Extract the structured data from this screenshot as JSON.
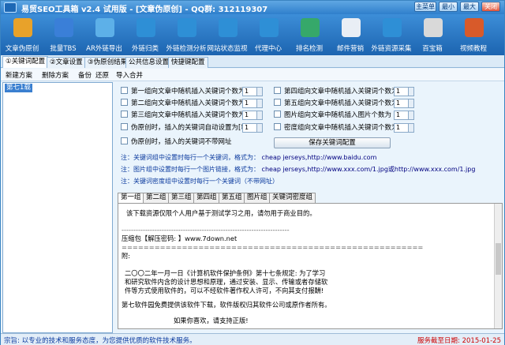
{
  "window": {
    "title": "易贸SEO工具箱 v2.4 试用版 - [文章伪原创] - QQ群: 312119307",
    "buttons": [
      "主菜单",
      "最小",
      "最大",
      "关闭"
    ]
  },
  "toolbar": {
    "items": [
      {
        "label": "文章伪原创",
        "icon": "books-icon",
        "color": "#e8a22a"
      },
      {
        "label": "批量TBS",
        "icon": "lightning-icon",
        "color": "#3a7fd8"
      },
      {
        "label": "AR外链导出",
        "icon": "monitor-icon",
        "color": "#5db0e8"
      },
      {
        "label": "外链归类",
        "icon": "globe-icon",
        "color": "#2e8fd6"
      },
      {
        "label": "外链检测分析",
        "icon": "globe-check-icon",
        "color": "#2e8fd6"
      },
      {
        "label": "网站状态监视",
        "icon": "globe-eye-icon",
        "color": "#2e8fd6"
      },
      {
        "label": "代理中心",
        "icon": "globe-proxy-icon",
        "color": "#2e8fd6"
      },
      {
        "label": "排名检测",
        "icon": "bar-chart-icon",
        "color": "#36a86a"
      },
      {
        "label": "邮件营销",
        "icon": "envelope-icon",
        "color": "#e9eef5"
      },
      {
        "label": "外链资源采集",
        "icon": "globe-collect-icon",
        "color": "#2e8fd6"
      },
      {
        "label": "百宝箱",
        "icon": "toolbox-icon",
        "color": "#d9d9d9"
      },
      {
        "label": "视频教程",
        "icon": "gift-icon",
        "color": "#d85a2a"
      }
    ]
  },
  "tabs": [
    "①关键词配置",
    "②文章设置",
    "③伪原创结果",
    "公共信息设置",
    "快捷键配置"
  ],
  "subbar": [
    "新建方案",
    "删除方案",
    "备份",
    "还原",
    "导入合并"
  ],
  "left": {
    "selected": "第七1载"
  },
  "options": {
    "left_col": [
      {
        "label": "第一组向文章中随机插入关键词个数为",
        "value": "1"
      },
      {
        "label": "第二组向文章中随机插入关键词个数为",
        "value": "1"
      },
      {
        "label": "第三组向文章中随机插入关键词个数为",
        "value": "1"
      },
      {
        "label": "伪原创时，插入的关键词自动设置为[粗体]",
        "value": "1"
      },
      {
        "label": "伪原创时，插入的关键词不带网址",
        "value": ""
      }
    ],
    "right_col": [
      {
        "label": "第四组向文章中随机插入关键词个数为",
        "value": "1"
      },
      {
        "label": "第五组向文章中随机插入关键词个数为",
        "value": "1"
      },
      {
        "label": "图片组向文章中随机插入图片个数为",
        "value": "1"
      },
      {
        "label": "密度组向文章中随机插入关键词个数为",
        "value": "1"
      }
    ],
    "save": "保存关键词配置"
  },
  "notes": [
    {
      "text": "注：关键词组中设置时每行一个关键词，格式为：",
      "example": "cheap jerseys,http://www.baidu.com"
    },
    {
      "text": "注：图片组中设置时每行一个图片链接，格式为：",
      "example": "cheap jerseys,http://www.xxx.com/1.jpg或http://www.xxx.com/1.jpg"
    },
    {
      "text": "注：关键词密度组中设置时每行一个关键词（不带网址）",
      "example": ""
    }
  ],
  "editor_tabs": [
    "第一组",
    "第二组",
    "第三组",
    "第四组",
    "第五组",
    "图片组",
    "关键词密度组"
  ],
  "editor_lines": [
    "该下载资源仅限个人用户基于测试学习之用，请勿用于商业目的。",
    "-----------------------------------------------------------------------",
    "压缩包【解压密码: 】www.7down.net",
    "=======================================================",
    "附:",
    "二〇〇二年一月一日《计算机软件保护条例》第十七条规定: 为了学习",
    "和研究软件内含的设计思想和原理，通过安装、显示、传输或者存储软",
    "件等方式使用软件的，可以不经软件著作权人许可，不向其支付报酬!",
    "第七软件园免费提供该软件下载，软件版权归其软件公司或原作者所有。",
    "如果你喜欢，请支持正版!"
  ],
  "status": {
    "left": "宗旨: 以专业的技术和服务态度，为您提供优质的软件技术服务。",
    "right": "服务截至日期: 2015-01-25"
  }
}
